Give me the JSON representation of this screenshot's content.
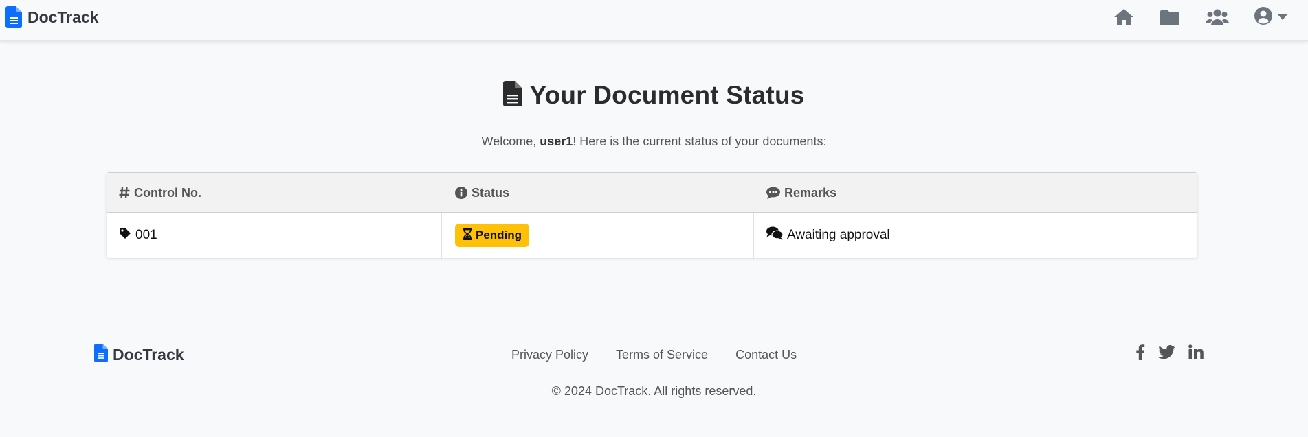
{
  "brand": {
    "name": "DocTrack",
    "icon": "file-text-icon",
    "accent_color": "#0d6efd"
  },
  "nav": {
    "icons": [
      "home-icon",
      "folder-icon",
      "users-icon",
      "user-circle-icon",
      "caret-down-icon"
    ],
    "icon_color": "#6c757d"
  },
  "main": {
    "title": "Your Document Status",
    "title_icon": "file-text-icon",
    "welcome_prefix": "Welcome, ",
    "username": "user1",
    "welcome_suffix": "! Here is the current status of your documents:"
  },
  "table": {
    "headers": [
      {
        "label": "Control No.",
        "icon": "hashtag-icon"
      },
      {
        "label": "Status",
        "icon": "info-circle-icon"
      },
      {
        "label": "Remarks",
        "icon": "comment-dots-icon"
      }
    ],
    "rows": [
      {
        "control_no": "001",
        "control_icon": "tag-icon",
        "status": "Pending",
        "status_icon": "hourglass-icon",
        "status_color": "#ffc107",
        "remarks": "Awaiting approval",
        "remarks_icon": "comments-icon"
      }
    ]
  },
  "footer": {
    "brand": "DocTrack",
    "links": [
      "Privacy Policy",
      "Terms of Service",
      "Contact Us"
    ],
    "social": [
      "facebook-icon",
      "twitter-icon",
      "linkedin-icon"
    ],
    "copyright": "© 2024 DocTrack. All rights reserved."
  }
}
